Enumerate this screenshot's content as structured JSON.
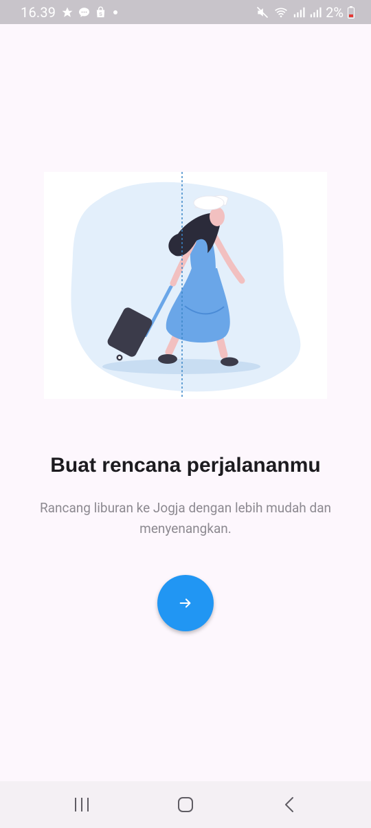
{
  "status_bar": {
    "time": "16.39",
    "battery": "2%",
    "left_icons": [
      "star-icon",
      "chat-icon",
      "shopping-bag-icon",
      "dot-icon"
    ],
    "right_icons": [
      "mute-icon",
      "wifi-icon",
      "signal-icon",
      "signal-icon",
      "battery-icon"
    ]
  },
  "onboarding": {
    "title": "Buat rencana perjalananmu",
    "description": "Rancang liburan ke Jogja dengan lebih mudah dan menyenangkan.",
    "next_icon": "arrow-right-icon"
  },
  "nav_bar": {
    "buttons": [
      "recent-apps-icon",
      "home-icon",
      "back-icon"
    ]
  },
  "colors": {
    "accent": "#2196f3",
    "background": "#fdf7fd",
    "title": "#1c1b1f",
    "description": "#8c8990"
  }
}
